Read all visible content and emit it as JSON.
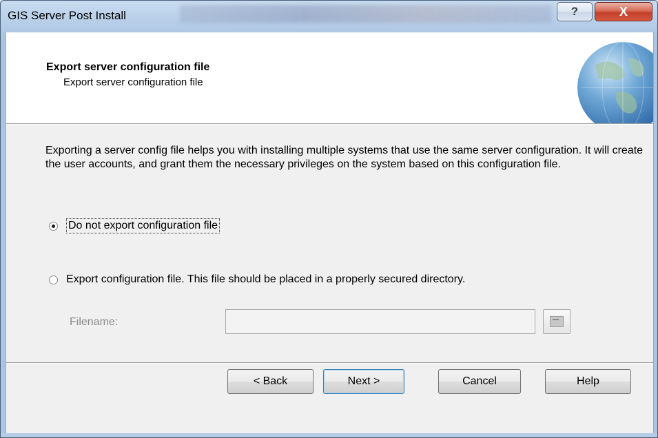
{
  "window": {
    "title": "GIS Server Post Install",
    "help_glyph": "?",
    "close_glyph": "X"
  },
  "header": {
    "title": "Export server configuration file",
    "subtitle": "Export server configuration file",
    "icon": "globe-icon"
  },
  "description": "Exporting a server config file  helps you with installing multiple systems that use the same server configuration.  It will create the user accounts, and grant them the necessary privileges on the system based on this configuration file.",
  "options": [
    {
      "label": "Do not export configuration file",
      "selected": true
    },
    {
      "label": "Export configuration file. This file should be placed in a properly secured directory.",
      "selected": false
    }
  ],
  "filename": {
    "label": "Filename:",
    "value": "",
    "enabled": false
  },
  "buttons": {
    "back": "< Back",
    "next": "Next >",
    "cancel": "Cancel",
    "help": "Help"
  },
  "colors": {
    "titlebar": "#b8cfe8",
    "close_button": "#c2402a",
    "client_bg": "#f0f0f0",
    "default_button_border": "#3c7fb1"
  }
}
